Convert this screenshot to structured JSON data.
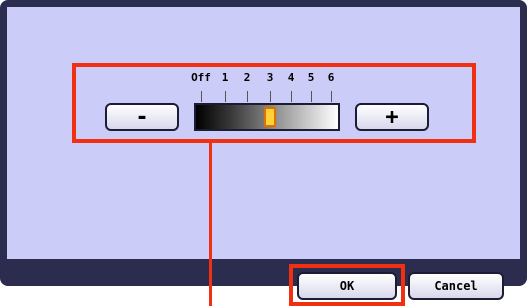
{
  "density": {
    "ticks": [
      "Off",
      "1",
      "2",
      "3",
      "4",
      "5",
      "6"
    ],
    "selected_level": "3",
    "minus_label": "-",
    "plus_label": "+"
  },
  "footer": {
    "ok_label": "OK",
    "cancel_label": "Cancel"
  },
  "colors": {
    "screen_bg": "#ccccf8",
    "frame": "#2c2c4e",
    "highlight": "#f03010",
    "handle": "#ffd23a"
  }
}
